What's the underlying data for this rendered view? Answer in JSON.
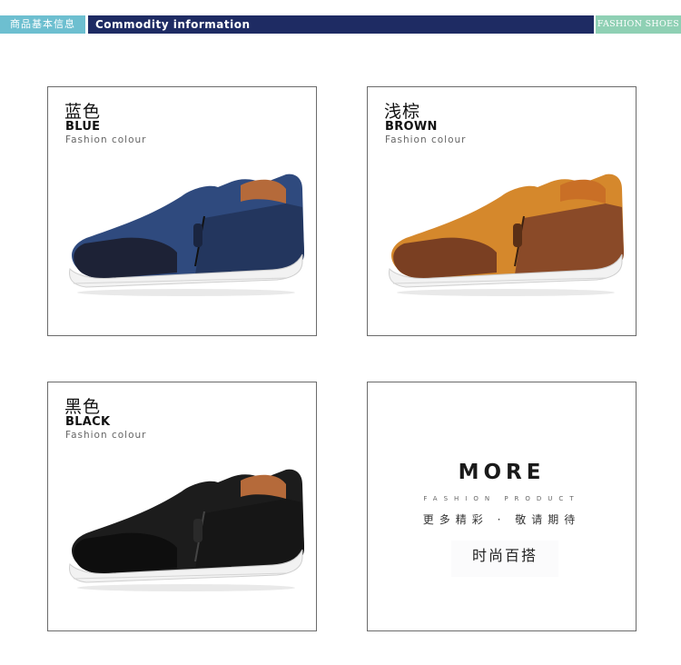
{
  "banner": {
    "left_label": "商品基本信息",
    "title": "Commodity information",
    "right_label": "FASHION SHOES"
  },
  "colors_section": [
    {
      "cn": "蓝色",
      "en": "BLUE",
      "sub": "Fashion colour",
      "shoe_color": "#2f4a7e"
    },
    {
      "cn": "浅棕",
      "en": "BROWN",
      "sub": "Fashion colour",
      "shoe_color": "#d5882c"
    },
    {
      "cn": "黑色",
      "en": "BLACK",
      "sub": "Fashion colour",
      "shoe_color": "#1c1c1c"
    }
  ],
  "more": {
    "title": "MORE",
    "subtitle": "FASHION PRODUCT",
    "tagline": "更多精彩 · 敬请期待",
    "button": "时尚百搭"
  }
}
